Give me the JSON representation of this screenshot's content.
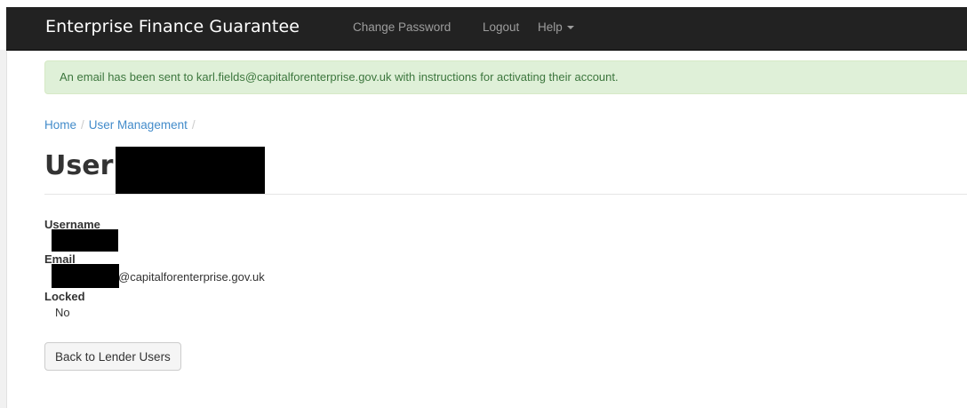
{
  "navbar": {
    "brand": "Enterprise Finance Guarantee",
    "links": {
      "change_password": "Change Password",
      "logout": "Logout",
      "help": "Help"
    }
  },
  "alert": {
    "message": "An email has been sent to karl.fields@capitalforenterprise.gov.uk with instructions for activating their account."
  },
  "breadcrumb": {
    "home": "Home",
    "user_management": "User Management",
    "separator": "/"
  },
  "page": {
    "title": "User:"
  },
  "details": {
    "username_label": "Username",
    "email_label": "Email",
    "email_domain": "@capitalforenterprise.gov.uk",
    "locked_label": "Locked",
    "locked_value": "No"
  },
  "actions": {
    "back_button": "Back to Lender Users"
  },
  "colors": {
    "navbar_bg": "#222222",
    "alert_bg": "#dff0d8",
    "alert_text": "#3c763d",
    "link": "#428bca",
    "redaction": "#000000"
  }
}
